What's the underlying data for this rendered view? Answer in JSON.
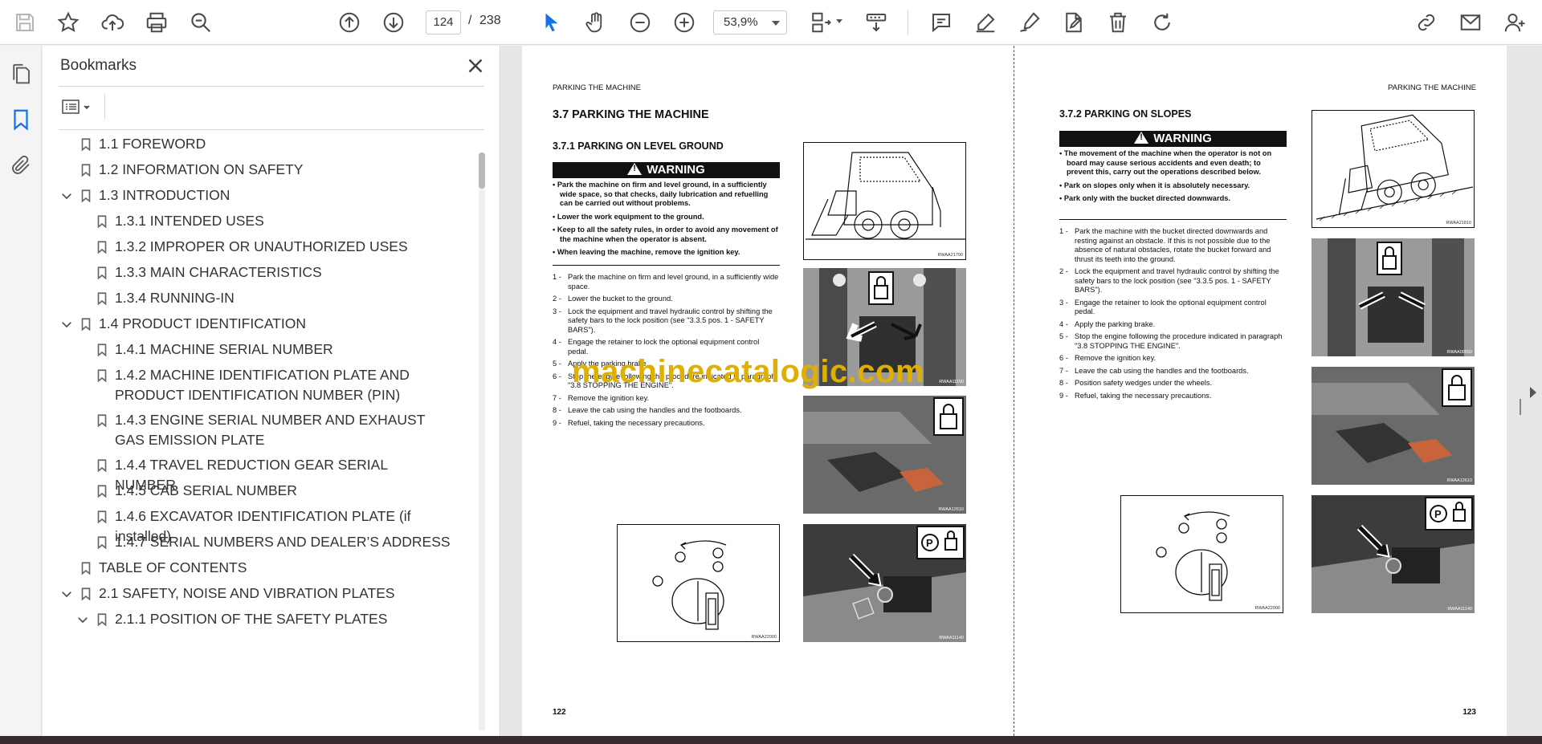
{
  "toolbar": {
    "page_current": "124",
    "page_separator": "/",
    "page_total": "238",
    "zoom": "53,9%"
  },
  "bookmarks": {
    "title": "Bookmarks",
    "items": [
      {
        "label": "1.1 FOREWORD"
      },
      {
        "label": "1.2 INFORMATION ON SAFETY"
      },
      {
        "label": "1.3 INTRODUCTION"
      },
      {
        "label": "1.3.1 INTENDED USES"
      },
      {
        "label": "1.3.2 IMPROPER OR UNAUTHORIZED USES"
      },
      {
        "label": "1.3.3 MAIN CHARACTERISTICS"
      },
      {
        "label": "1.3.4 RUNNING-IN"
      },
      {
        "label": "1.4 PRODUCT IDENTIFICATION"
      },
      {
        "label": "1.4.1 MACHINE SERIAL NUMBER"
      },
      {
        "label": "1.4.2 MACHINE IDENTIFICATION PLATE AND PRODUCT IDENTIFICATION NUMBER (PIN)"
      },
      {
        "label": "1.4.3 ENGINE SERIAL NUMBER AND EXHAUST GAS EMISSION PLATE"
      },
      {
        "label": "1.4.4 TRAVEL REDUCTION GEAR SERIAL NUMBER"
      },
      {
        "label": "1.4.5 CAB SERIAL NUMBER"
      },
      {
        "label": "1.4.6 EXCAVATOR IDENTIFICATION PLATE (if installed)"
      },
      {
        "label": "1.4.7 SERIAL NUMBERS AND DEALER’S ADDRESS"
      },
      {
        "label": "TABLE OF CONTENTS"
      },
      {
        "label": "2.1 SAFETY, NOISE AND VIBRATION PLATES"
      },
      {
        "label": "2.1.1 POSITION OF THE SAFETY PLATES"
      }
    ]
  },
  "left_page": {
    "header": "PARKING THE MACHINE",
    "section": "3.7   PARKING THE MACHINE",
    "subsection": "3.7.1   PARKING ON LEVEL GROUND",
    "warning": "WARNING",
    "bullets": [
      "Park the machine on firm and level ground, in a sufficiently wide space, so that checks, daily lubrication and refuelling can be carried out without problems.",
      "Lower the work equipment to the ground.",
      "Keep to all the safety rules, in order to avoid any movement of the machine when the operator is absent.",
      "When leaving the machine, remove the ignition key."
    ],
    "steps": [
      {
        "n": "1 -",
        "t": "Park the machine on firm and level ground, in a sufficiently wide space."
      },
      {
        "n": "2 -",
        "t": "Lower the bucket to the ground."
      },
      {
        "n": "3 -",
        "t": "Lock the equipment and travel hydraulic control by shifting the safety bars to the lock position (see \"3.3.5 pos. 1 - SAFETY BARS\")."
      },
      {
        "n": "4 -",
        "t": "Engage the retainer to lock the optional equipment control pedal."
      },
      {
        "n": "5 -",
        "t": "Apply the parking brake."
      },
      {
        "n": "6 -",
        "t": "Stop the engine following the procedure indicated in paragraph \"3.8 STOPPING THE ENGINE\"."
      },
      {
        "n": "7 -",
        "t": "Remove the ignition key."
      },
      {
        "n": "8 -",
        "t": "Leave the cab using the handles and the footboards."
      },
      {
        "n": "9 -",
        "t": "Refuel, taking the necessary precautions."
      }
    ],
    "fig_codes": [
      "RWAA21790",
      "RWAA11150",
      "RWAA12610",
      "RWAA11140",
      "RWAA22000"
    ],
    "page_number": "122"
  },
  "right_page": {
    "header": "PARKING THE MACHINE",
    "subsection": "3.7.2   PARKING ON SLOPES",
    "warning": "WARNING",
    "bullets": [
      "The movement of the machine when the operator is not on board may cause serious accidents and even death; to prevent this, carry out the operations described below.",
      "Park on slopes only when it is absolutely necessary.",
      "Park only with the bucket directed downwards."
    ],
    "steps": [
      {
        "n": "1 -",
        "t": "Park the machine with the bucket directed downwards and resting against an obstacle. If this is not possible due to the absence of natural obstacles, rotate the bucket forward and thrust its teeth into the ground."
      },
      {
        "n": "2 -",
        "t": "Lock the equipment and travel hydraulic control by shifting the safety bars to the lock position (see \"3.3.5 pos. 1 - SAFETY BARS\")."
      },
      {
        "n": "3 -",
        "t": "Engage the retainer to look the optional equipment control pedal."
      },
      {
        "n": "4 -",
        "t": "Apply the parking brake."
      },
      {
        "n": "5 -",
        "t": "Stop the engine following the procedure indicated in paragraph \"3.8 STOPPING THE ENGINE\"."
      },
      {
        "n": "6 -",
        "t": "Remove the ignition key."
      },
      {
        "n": "7 -",
        "t": "Leave the cab using the handles and the footboards."
      },
      {
        "n": "8 -",
        "t": "Position safety wedges under the wheels."
      },
      {
        "n": "9 -",
        "t": "Refuel, taking the necessary precautions."
      }
    ],
    "fig_codes": [
      "RWAA21810",
      "RWAA09550",
      "RWAA12610",
      "RWAA11140",
      "RWAA22000"
    ],
    "page_number": "123"
  },
  "watermark": "machinecatalogic.com",
  "colors": {
    "accent": "#1473e6",
    "watermark": "#e0b000"
  }
}
